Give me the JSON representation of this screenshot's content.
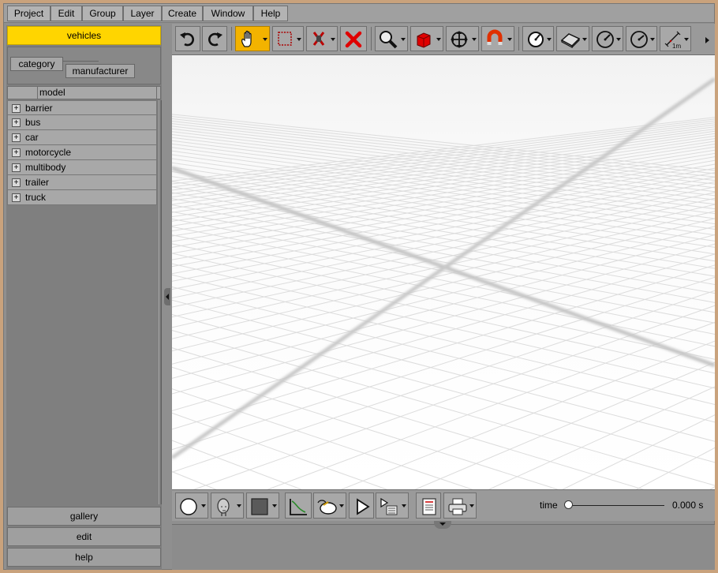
{
  "menu": [
    "Project",
    "Edit",
    "Group",
    "Layer",
    "Create",
    "Window",
    "Help"
  ],
  "left_panel": {
    "header": "vehicles",
    "tabs": [
      "category",
      "manufacturer"
    ],
    "column": "model",
    "tree": [
      "barrier",
      "bus",
      "car",
      "motorcycle",
      "multibody",
      "trailer",
      "truck"
    ],
    "buttons": [
      "gallery",
      "edit",
      "help"
    ]
  },
  "toolbar": {
    "icons": [
      "undo-icon",
      "redo-icon",
      "hand-pan-icon",
      "select-box-icon",
      "cut-icon",
      "delete-icon",
      "zoom-icon",
      "cube-icon",
      "move-icon",
      "magnet-icon",
      "measure-angle-icon",
      "terrain-icon",
      "gauge-icon",
      "gauge2-icon",
      "ruler-icon"
    ],
    "ruler_label": "1m"
  },
  "bottom_toolbar": {
    "time_label": "time",
    "time_value": "0.000 s",
    "slider_position": 0
  },
  "colors": {
    "accent": "#ffd500",
    "active_tool": "#f3b300",
    "cube": "#e00000",
    "delete": "#e00000"
  }
}
